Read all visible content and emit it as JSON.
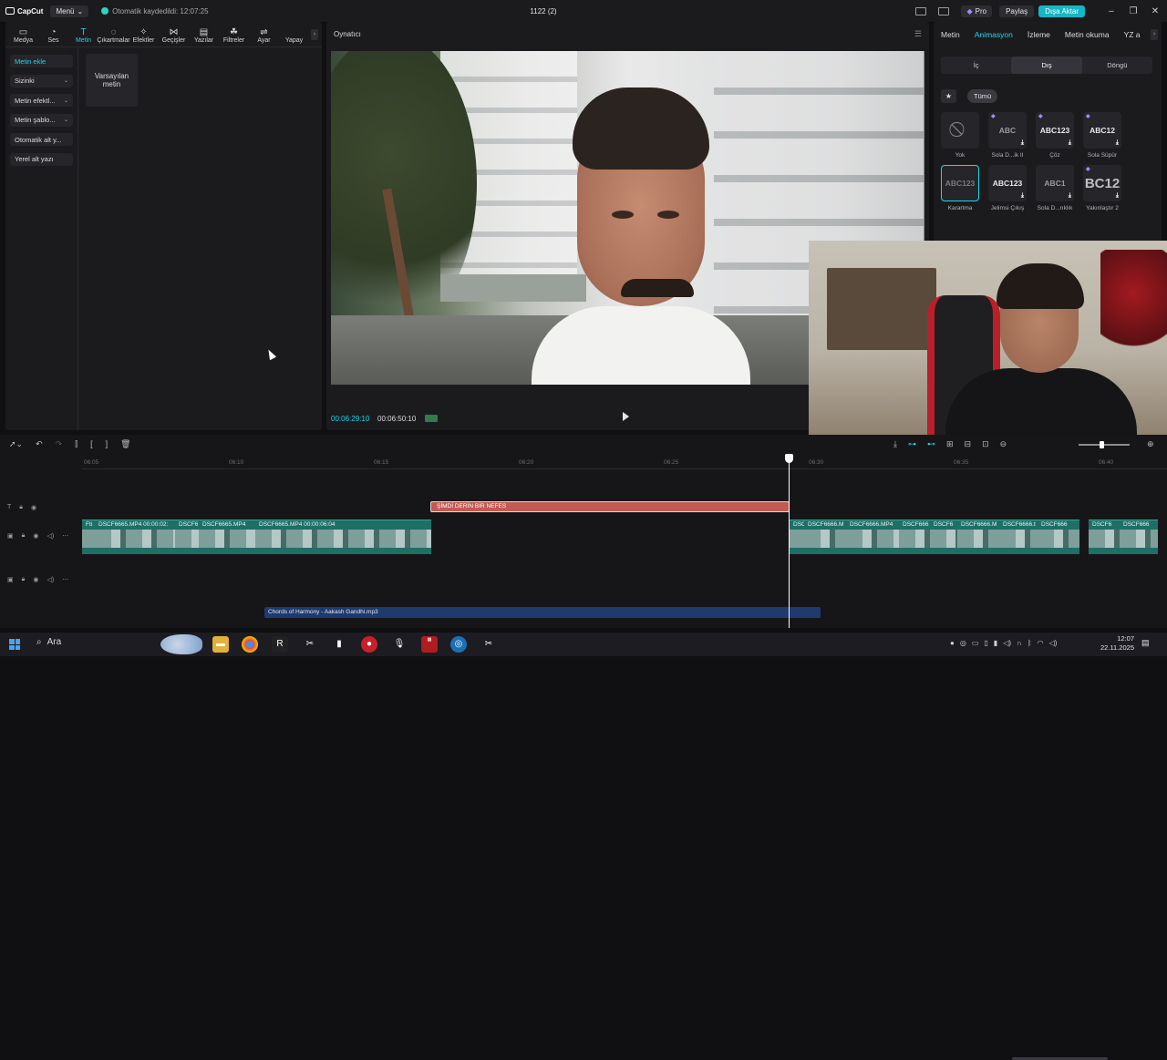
{
  "titlebar": {
    "app_name": "CapCut",
    "menu_label": "Menü",
    "autosave": "Otomatik kaydedildi: 12:07:25",
    "project_title": "1122 (2)",
    "pro_label": "Pro",
    "share_label": "Paylaş",
    "export_label": "Dışa Aktar"
  },
  "toolbar": {
    "items": [
      {
        "label": "Medya",
        "icon": "media-icon"
      },
      {
        "label": "Ses",
        "icon": "audio-icon"
      },
      {
        "label": "Metin",
        "icon": "text-icon"
      },
      {
        "label": "Çıkartmalar",
        "icon": "sticker-icon"
      },
      {
        "label": "Efektler",
        "icon": "effects-icon"
      },
      {
        "label": "Geçişler",
        "icon": "transitions-icon"
      },
      {
        "label": "Yazılar",
        "icon": "captions-icon"
      },
      {
        "label": "Filtreler",
        "icon": "filters-icon"
      },
      {
        "label": "Ayar",
        "icon": "adjust-icon"
      },
      {
        "label": "Yapay",
        "icon": "ai-icon"
      }
    ],
    "active_index": 2
  },
  "sidebar": {
    "items": [
      {
        "label": "Metin ekle"
      },
      {
        "label": "Sizinki"
      },
      {
        "label": "Metin efektl..."
      },
      {
        "label": "Metin şablo..."
      },
      {
        "label": "Otomatik alt y..."
      },
      {
        "label": "Yerel alt yazı"
      }
    ],
    "default_text_card": "Varsayılan metin"
  },
  "player": {
    "title": "Oynatıcı",
    "time_current": "00:06:29:10",
    "time_total": "00:06:50:10"
  },
  "right_panel": {
    "tabs": [
      "Metin",
      "Animasyon",
      "İzleme",
      "Metin okuma",
      "YZ a"
    ],
    "active_tab": 1,
    "segments": [
      "İç",
      "Dış",
      "Döngü"
    ],
    "active_segment": 1,
    "filter_all": "Tümü",
    "animations": [
      {
        "preview": "⃠",
        "label": "Yok"
      },
      {
        "preview": "ABC",
        "label": "Sola D...ik II"
      },
      {
        "preview": "ABC123",
        "label": "Çöz"
      },
      {
        "preview": "ABC12",
        "label": "Sola Süpür"
      },
      {
        "preview": "ABC123",
        "label": "Karartma"
      },
      {
        "preview": "ABC123",
        "label": "Jelimsi Çıkış"
      },
      {
        "preview": "ABC1",
        "label": "Sola D...rıklık"
      },
      {
        "preview": "BC12",
        "label": "Yakınlaştır 2"
      }
    ]
  },
  "timeline": {
    "ruler_ticks": [
      "06:05",
      "06:10",
      "06:15",
      "06:20",
      "06:25",
      "06:30",
      "06:35",
      "06:40"
    ],
    "text_clip": "ŞİMDİ DERİN BİR NEFES",
    "video_clips_left": [
      {
        "label": "Fti"
      },
      {
        "label": "DSCF6665.MP4   00:00:02:"
      },
      {
        "label": "DSCF6"
      },
      {
        "label": "DSCF6665.MP4"
      },
      {
        "label": "DSCF6665.MP4   00:00:06:04"
      }
    ],
    "video_clips_right": [
      {
        "label": "DSC"
      },
      {
        "label": "DSCF6666.M"
      },
      {
        "label": "DSCF6666.MP4"
      },
      {
        "label": "DSCF666"
      },
      {
        "label": "DSCF6"
      },
      {
        "label": "DSCF6666.M"
      },
      {
        "label": "DSCF6666.t"
      },
      {
        "label": "DSCF666"
      },
      {
        "label": "DSCF6"
      },
      {
        "label": "DSCF666"
      }
    ],
    "audio_clip": "Chords of Harmony - Aakash Gandhi.mp3"
  },
  "taskbar": {
    "search_label": "Ara",
    "time": "12:07",
    "date": "22.11.2025"
  }
}
